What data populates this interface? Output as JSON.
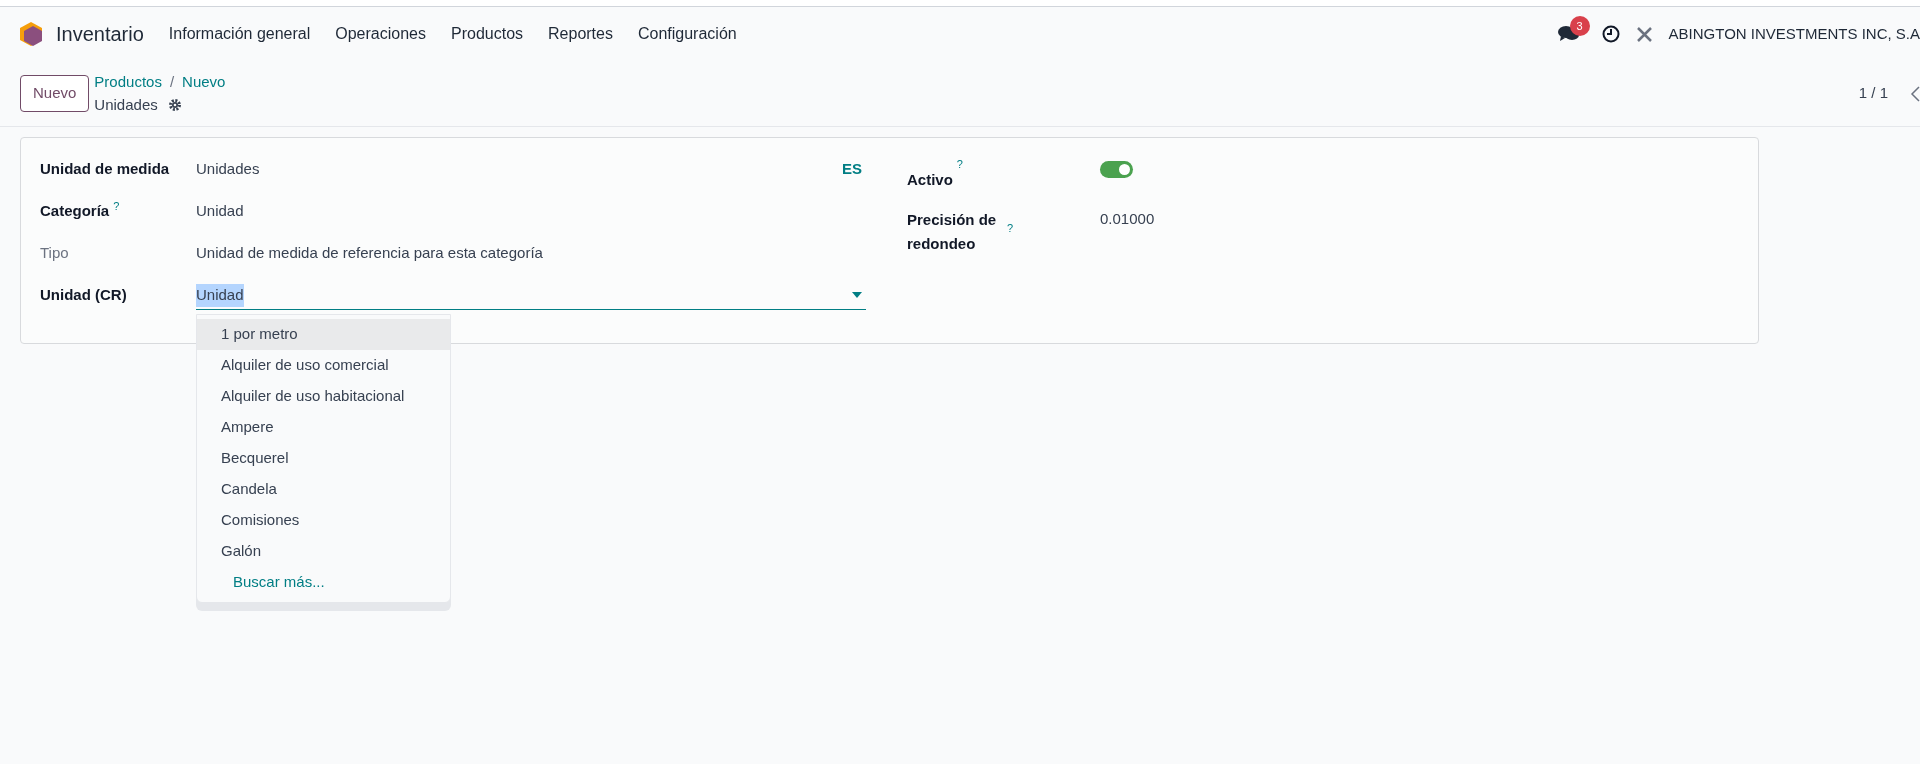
{
  "navbar": {
    "app_name": "Inventario",
    "menu": [
      "Información general",
      "Operaciones",
      "Productos",
      "Reportes",
      "Configuración"
    ],
    "messages_badge": "3",
    "company": "ABINGTON INVESTMENTS INC, S.A"
  },
  "control_panel": {
    "new_button": "Nuevo",
    "breadcrumb": [
      "Productos",
      "Nuevo"
    ],
    "separator": "/",
    "current": "Unidades",
    "pager": "1 / 1"
  },
  "form": {
    "left": [
      {
        "kind": "text",
        "label": "Unidad de medida",
        "bold": true,
        "value": "Unidades",
        "lang": "ES"
      },
      {
        "kind": "text",
        "label": "Categoría",
        "bold": true,
        "help": "?",
        "value": "Unidad"
      },
      {
        "kind": "text",
        "label": "Tipo",
        "bold": false,
        "value": "Unidad de medida de referencia para esta categoría"
      },
      {
        "kind": "select",
        "label": "Unidad (CR)",
        "bold": true,
        "value": "Unidad"
      }
    ],
    "right": [
      {
        "kind": "toggle",
        "label": "Activo",
        "help": "?",
        "on": true
      },
      {
        "kind": "text",
        "label": "Precisión de redondeo",
        "help": "?",
        "value": "0.01000"
      }
    ]
  },
  "dropdown": {
    "options": [
      {
        "label": "1 por metro",
        "selected": true
      },
      {
        "label": "Alquiler de uso comercial",
        "selected": false
      },
      {
        "label": "Alquiler de uso habitacional",
        "selected": false
      },
      {
        "label": "Ampere",
        "selected": false
      },
      {
        "label": "Becquerel",
        "selected": false
      },
      {
        "label": "Candela",
        "selected": false
      },
      {
        "label": "Comisiones",
        "selected": false
      },
      {
        "label": "Galón",
        "selected": false
      }
    ],
    "more": "Buscar más..."
  }
}
